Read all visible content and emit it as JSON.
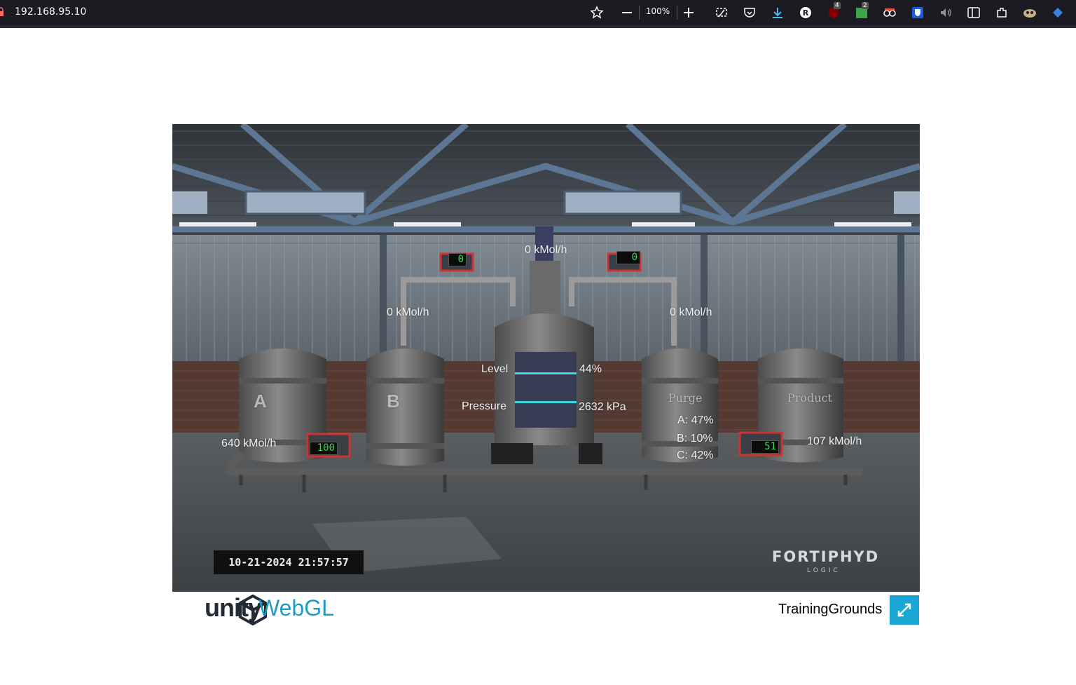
{
  "browser": {
    "url": "192.168.95.10",
    "zoom": "100%",
    "badge_ublock": "4",
    "badge_ext": "2"
  },
  "scada": {
    "flow_top": "0 kMol/h",
    "flow_b_in": "0 kMol/h",
    "flow_purge_in": "0 kMol/h",
    "flow_a": "640 kMol/h",
    "flow_product": "107 kMol/h",
    "valve_left_top": "0",
    "valve_right_top": "0",
    "valve_a": "100",
    "valve_product": "51",
    "level_label": "Level",
    "level_value": "44%",
    "pressure_label": "Pressure",
    "pressure_value": "2632 kPa",
    "purge_a": "A: 47%",
    "purge_b": "B: 10%",
    "purge_c": "C: 42%",
    "tank_a": "A",
    "tank_b": "B",
    "tank_purge": "Purge",
    "tank_product": "Product",
    "datetime": "10-21-2024 21:57:57",
    "brand": "FORTIPHYD",
    "brand_sub": "LOGIC"
  },
  "footer": {
    "unity": "unity",
    "webgl": "WebGL",
    "title": "TrainingGrounds"
  },
  "colors": {
    "accent": "#1ba7d4",
    "lcd_green": "#27e84a",
    "cyan_bar": "#35d6e0"
  }
}
